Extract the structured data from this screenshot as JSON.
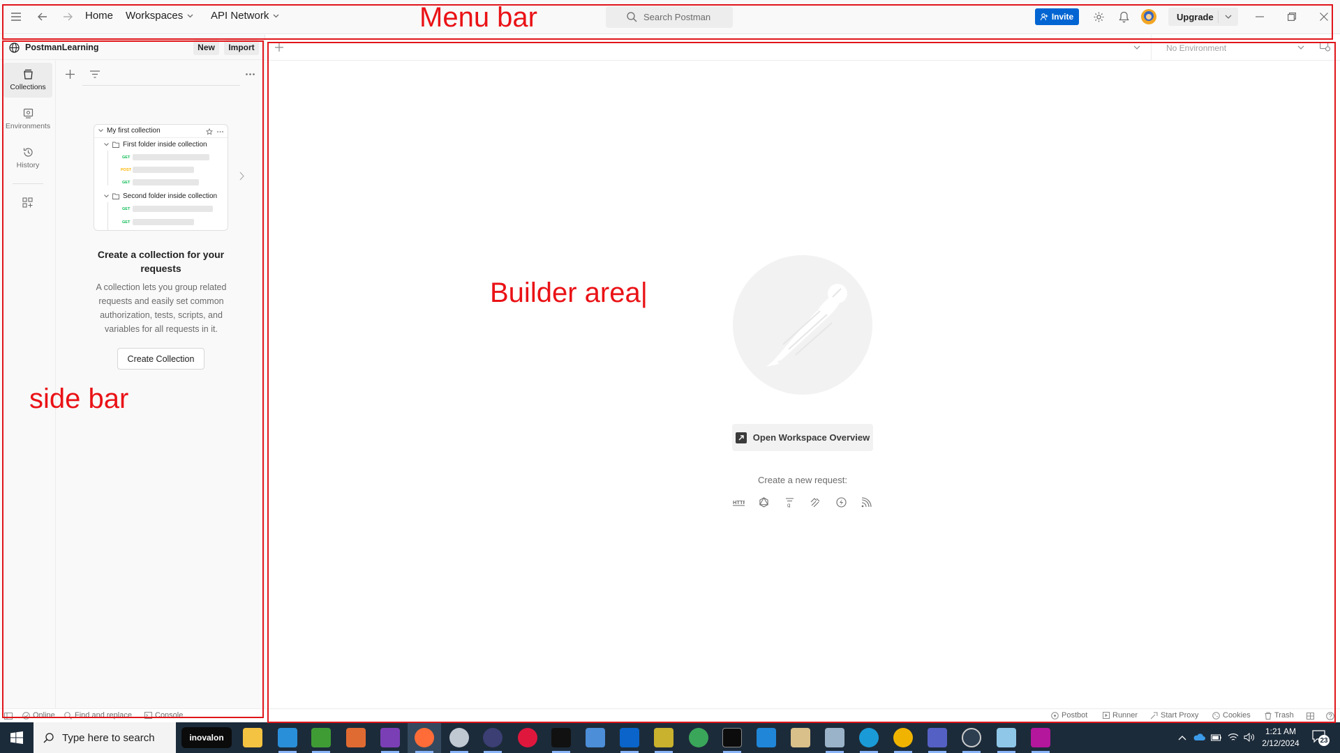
{
  "menu": {
    "home": "Home",
    "workspaces": "Workspaces",
    "api_network": "API Network",
    "search_placeholder": "Search Postman",
    "invite": "Invite",
    "upgrade": "Upgrade"
  },
  "sidebar": {
    "workspace_name": "PostmanLearning",
    "new_label": "New",
    "import_label": "Import",
    "rail": [
      {
        "label": "Collections",
        "icon": "collections-icon"
      },
      {
        "label": "Environments",
        "icon": "environments-icon"
      },
      {
        "label": "History",
        "icon": "history-icon"
      }
    ],
    "illustration": {
      "collection": "My first collection",
      "folder1": "First folder inside collection",
      "folder2": "Second folder inside collection",
      "methods": [
        "GET",
        "POST",
        "GET",
        "GET",
        "GET"
      ]
    },
    "empty_title": "Create a collection for your requests",
    "empty_desc": "A collection lets you group related requests and easily set common authorization, tests, scripts, and variables for all requests in it.",
    "create_collection": "Create Collection"
  },
  "builder": {
    "environment": "No Environment",
    "open_overview": "Open Workspace Overview",
    "create_new_request": "Create a new request:",
    "request_types": [
      "http-icon",
      "graphql-icon",
      "grpc-icon",
      "websocket-icon",
      "socketio-icon",
      "mqtt-icon"
    ]
  },
  "statusbar": {
    "online": "Online",
    "find_replace": "Find and replace",
    "console": "Console",
    "postbot": "Postbot",
    "runner": "Runner",
    "start_proxy": "Start Proxy",
    "cookies": "Cookies",
    "trash": "Trash"
  },
  "taskbar": {
    "search_placeholder": "Type here to search",
    "inovalon": "inovalon",
    "time": "1:21 AM",
    "date": "2/12/2024",
    "notifications": "23"
  },
  "annotations": {
    "menu_bar": "Menu bar",
    "builder_area": "Builder area|",
    "side_bar": "side bar"
  },
  "colors": {
    "annotation_red": "#e0151a",
    "invite_blue": "#0265d2",
    "get_green": "#0cbb52",
    "post_orange": "#ffb400"
  }
}
